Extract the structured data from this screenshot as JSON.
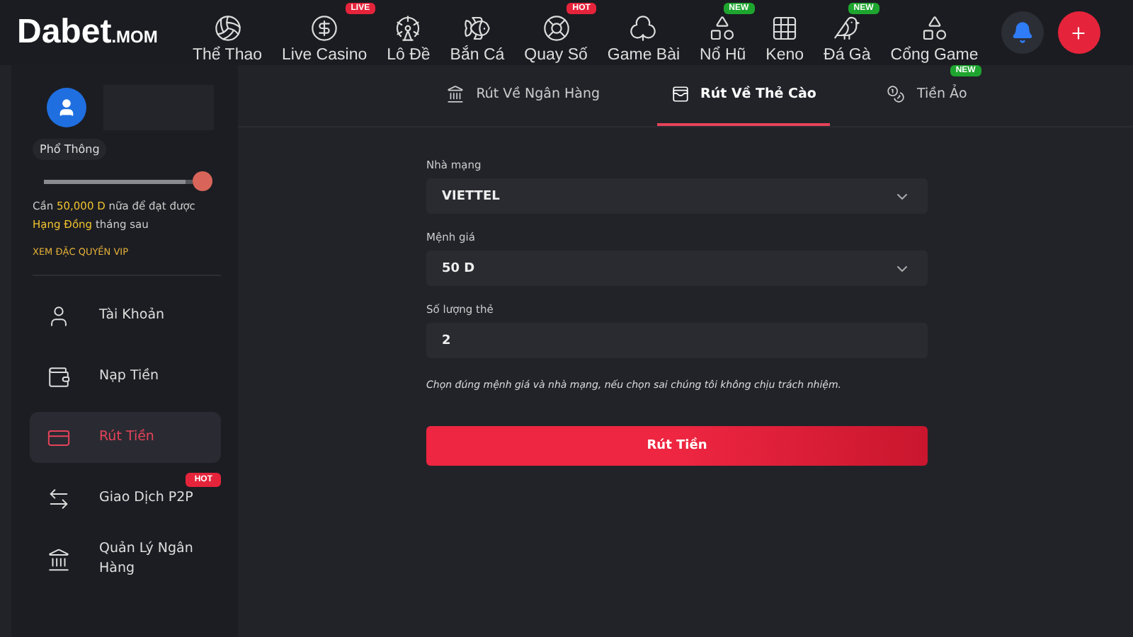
{
  "logo": {
    "brand": "Dabet",
    "suffix": ".MOM"
  },
  "nav": [
    {
      "label": "Thể Thao"
    },
    {
      "label": "Live Casino",
      "badge": "LIVE",
      "color": "#e5243b"
    },
    {
      "label": "Lô Đề"
    },
    {
      "label": "Bắn Cá"
    },
    {
      "label": "Quay Số",
      "badge": "HOT",
      "color": "#e5243b"
    },
    {
      "label": "Game Bài"
    },
    {
      "label": "Nổ Hũ",
      "badge": "NEW",
      "color": "#1ea52f"
    },
    {
      "label": "Keno"
    },
    {
      "label": "Đá Gà",
      "badge": "NEW",
      "color": "#1ea52f"
    },
    {
      "label": "Cổng Game"
    }
  ],
  "header_buttons": [
    {
      "kind": "bell"
    },
    {
      "kind": "plus"
    }
  ],
  "profile": {
    "rank": "Phổ Thông",
    "level": 0.95,
    "note": "Cần **50,000 D** nữa để đạt được **Hạng Đồng** tháng sau",
    "vip_link": "XEM ĐẶC QUYỀN VIP"
  },
  "menu": [
    {
      "label": "Tài Khoản",
      "selected": false
    },
    {
      "label": "Nạp Tiền",
      "selected": false
    },
    {
      "label": "Rút Tiền",
      "selected": true
    },
    {
      "label": "Giao Dịch P2P",
      "selected": false,
      "badge": "HOT"
    },
    {
      "label": "Quản Lý Ngân Hàng",
      "selected": false
    }
  ],
  "tabs": [
    {
      "label": "Rút Về Ngân Hàng",
      "selected": false
    },
    {
      "label": "Rút Về Thẻ Cào",
      "selected": true
    },
    {
      "label": "Tiền Ảo",
      "selected": false,
      "badge": "NEW"
    }
  ],
  "form": {
    "fields": [
      {
        "label": "Nhà mạng",
        "kind": "select",
        "value": "VIETTEL"
      },
      {
        "label": "Mệnh giá",
        "kind": "select",
        "value": "50 D"
      },
      {
        "label": "Số lượng thẻ",
        "kind": "input",
        "value": "2"
      }
    ],
    "note": "Chọn đúng mệnh giá và nhà mạng, nếu chọn sai chúng tôi không chịu trách nhiệm.",
    "submit": "Rút Tiền"
  }
}
